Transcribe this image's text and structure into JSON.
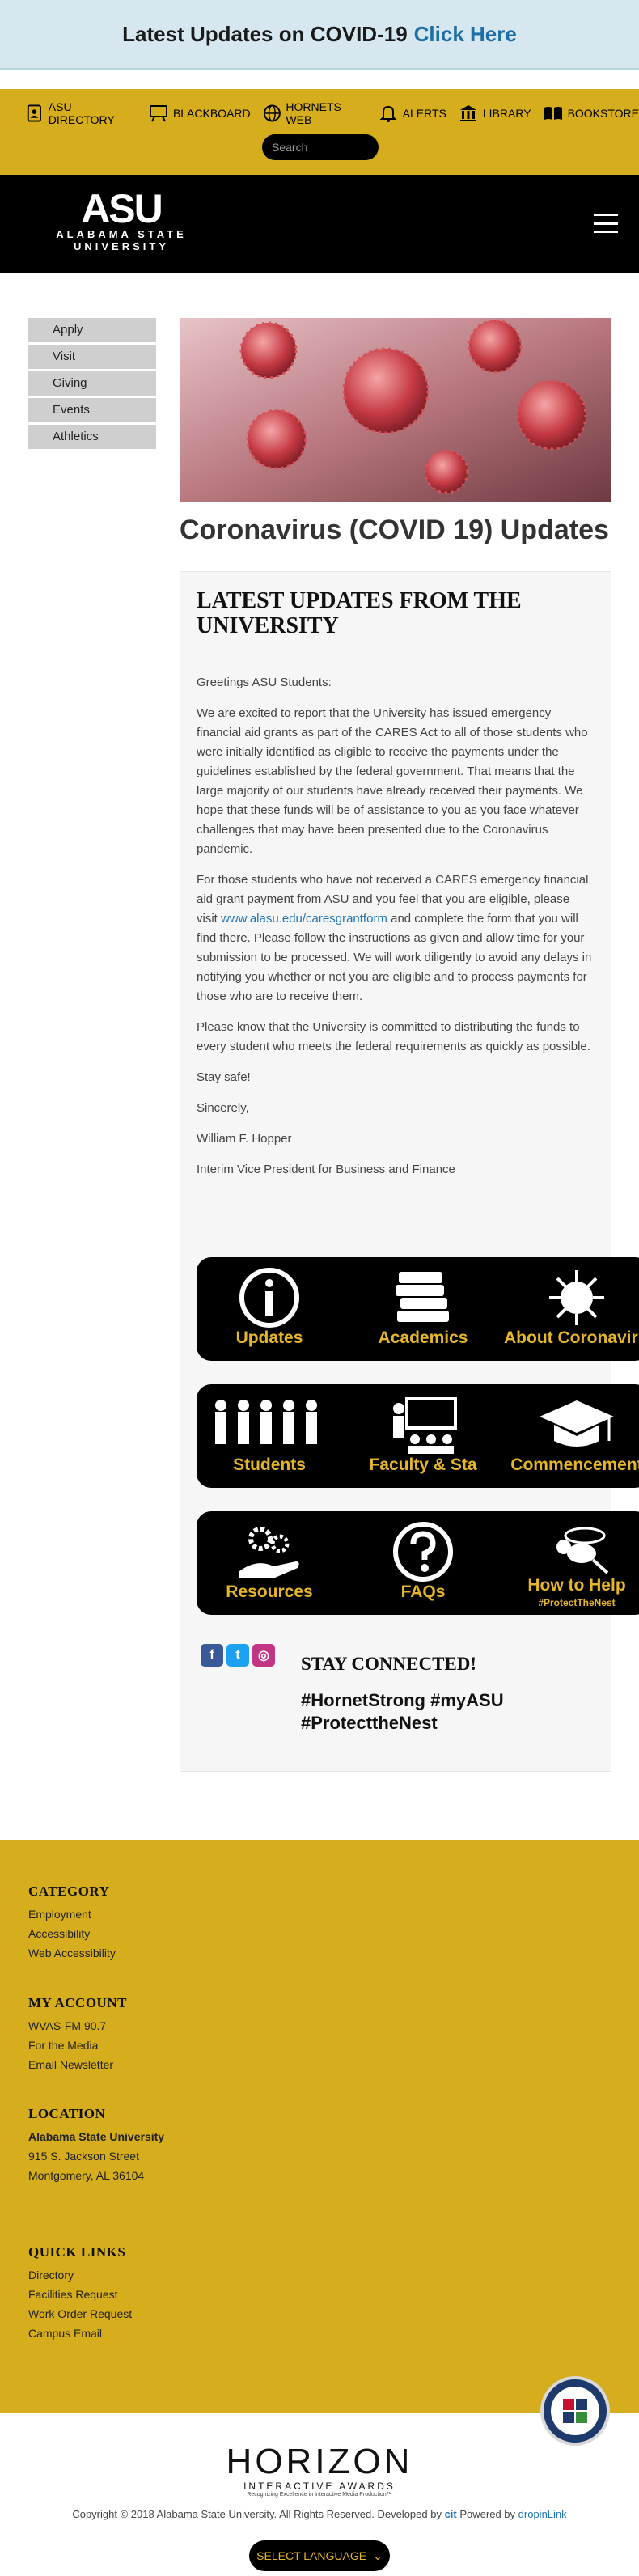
{
  "alert": {
    "text": "Latest Updates on COVID-19",
    "link": "Click Here"
  },
  "utility": {
    "links": [
      {
        "label": "ASU DIRECTORY",
        "icon": "directory-icon"
      },
      {
        "label": "BLACKBOARD",
        "icon": "blackboard-icon"
      },
      {
        "label": "HORNETS WEB",
        "icon": "globe-icon"
      },
      {
        "label": "ALERTS",
        "icon": "bell-icon"
      },
      {
        "label": "LIBRARY",
        "icon": "library-icon"
      },
      {
        "label": "BOOKSTORE",
        "icon": "book-icon"
      }
    ],
    "search_placeholder": "Search"
  },
  "header": {
    "logo_big": "ASU",
    "logo_small_1": "ALABAMA STATE",
    "logo_small_2": "UNIVERSITY"
  },
  "sidenav": [
    "Apply",
    "Visit",
    "Giving",
    "Events",
    "Athletics"
  ],
  "page_title": "Coronavirus (COVID 19) Updates",
  "content": {
    "heading": "LATEST UPDATES FROM THE UNIVERSITY",
    "greeting": "Greetings ASU Students:",
    "p1": "We are excited to report that the University has issued emergency financial aid grants as part of the CARES Act to all of those students who were initially identified as eligible to receive the payments under the guidelines established by the federal government. That means that the large majority of our students have already received their payments. We hope that these funds will be of assistance to you as you face whatever challenges that may have been presented due to the Coronavirus pandemic.",
    "p2_before": "For those students who have not received a CARES emergency financial aid grant payment from ASU and you feel that you are eligible, please visit ",
    "p2_link": "www.alasu.edu/caresgrantform",
    "p2_after": " and complete the form that you will find there. Please follow the instructions as given and allow time for your submission to be processed. We will work diligently to avoid any delays in notifying you whether or not you are eligible and to process payments for those who are to receive them.",
    "p3": "Please know that the University is committed to distributing the funds to every student who meets the federal requirements as quickly as possible.",
    "p4": "Stay safe!",
    "p5": "Sincerely,",
    "p6": "William F. Hopper",
    "p7": "Interim Vice President for Business and Finance"
  },
  "tiles": [
    [
      "Updates",
      "Academics",
      "About Coronavirus"
    ],
    [
      "Students",
      "Faculty & Sta",
      "Commencement"
    ],
    [
      "Resources",
      "FAQs",
      "How to Help"
    ]
  ],
  "tile_subcaption": "#ProtectTheNest",
  "connect": {
    "title": "STAY CONNECTED!",
    "hashtags": "#HornetStrong #myASU #ProtecttheNest"
  },
  "footer": {
    "category": {
      "title": "CATEGORY",
      "items": [
        "Employment",
        "Accessibility",
        "Web Accessibility"
      ]
    },
    "account": {
      "title": "MY ACCOUNT",
      "items": [
        "WVAS-FM 90.7",
        "For the Media",
        "Email Newsletter"
      ]
    },
    "location": {
      "title": "LOCATION",
      "name": "Alabama State University",
      "line1": "915 S. Jackson Street",
      "line2": "Montgomery, AL 36104"
    },
    "quick": {
      "title": "QUICK LINKS",
      "items": [
        "Directory",
        "Facilities Request",
        "Work Order Request",
        "Campus Email"
      ]
    }
  },
  "horizon": {
    "big": "HORIZON",
    "sub": "INTERACTIVE AWARDS",
    "tiny": "Recognizing Excellence in Interactive Media Production™"
  },
  "copyright": "Copyright © 2018 Alabama State University. All Rights Reserved. Developed by",
  "powered": "Powered by",
  "powered_brand": "dropinLink",
  "language": "SELECT LANGUAGE",
  "colors": {
    "gold": "#d6ad1c",
    "tile_text": "#e5b62b",
    "link": "#1e74b8"
  }
}
